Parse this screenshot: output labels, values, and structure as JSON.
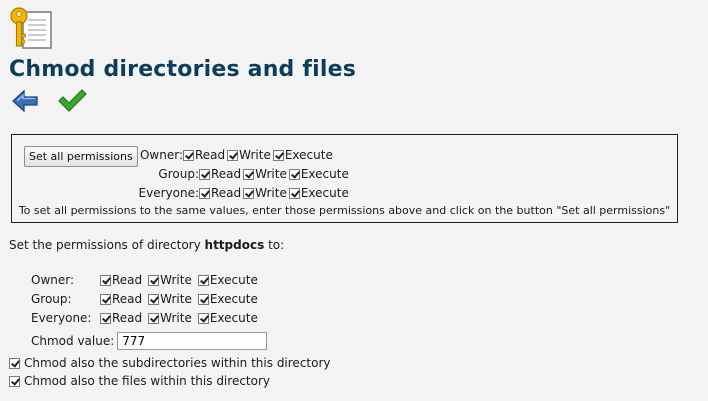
{
  "header": {
    "title": "Chmod directories and files"
  },
  "icons": {
    "page": "key-document-icon",
    "back": "back-arrow-icon",
    "confirm": "checkmark-icon"
  },
  "set_all": {
    "button_label": "Set all permissions",
    "rows": [
      {
        "label": "Owner:",
        "read": "Read",
        "write": "Write",
        "execute": "Execute"
      },
      {
        "label": "Group:",
        "read": "Read",
        "write": "Write",
        "execute": "Execute"
      },
      {
        "label": "Everyone:",
        "read": "Read",
        "write": "Write",
        "execute": "Execute"
      }
    ],
    "hint": "To set all permissions to the same values, enter those permissions above and click on the button \"Set all permissions\""
  },
  "directory": {
    "intro_prefix": "Set the permissions of directory",
    "name": "httpdocs",
    "intro_suffix": "to:",
    "rows": [
      {
        "label": "Owner:",
        "read": "Read",
        "write": "Write",
        "execute": "Execute"
      },
      {
        "label": "Group:",
        "read": "Read",
        "write": "Write",
        "execute": "Execute"
      },
      {
        "label": "Everyone:",
        "read": "Read",
        "write": "Write",
        "execute": "Execute"
      }
    ],
    "chmod_label": "Chmod value:",
    "chmod_value": "777"
  },
  "options": {
    "subdirs": "Chmod also the subdirectories within this directory",
    "files": "Chmod also the files within this directory"
  },
  "colors": {
    "title": "#0d3d5c",
    "back_arrow": "#3a6fb8",
    "checkmark": "#3aa832",
    "key": "#f2b705"
  }
}
